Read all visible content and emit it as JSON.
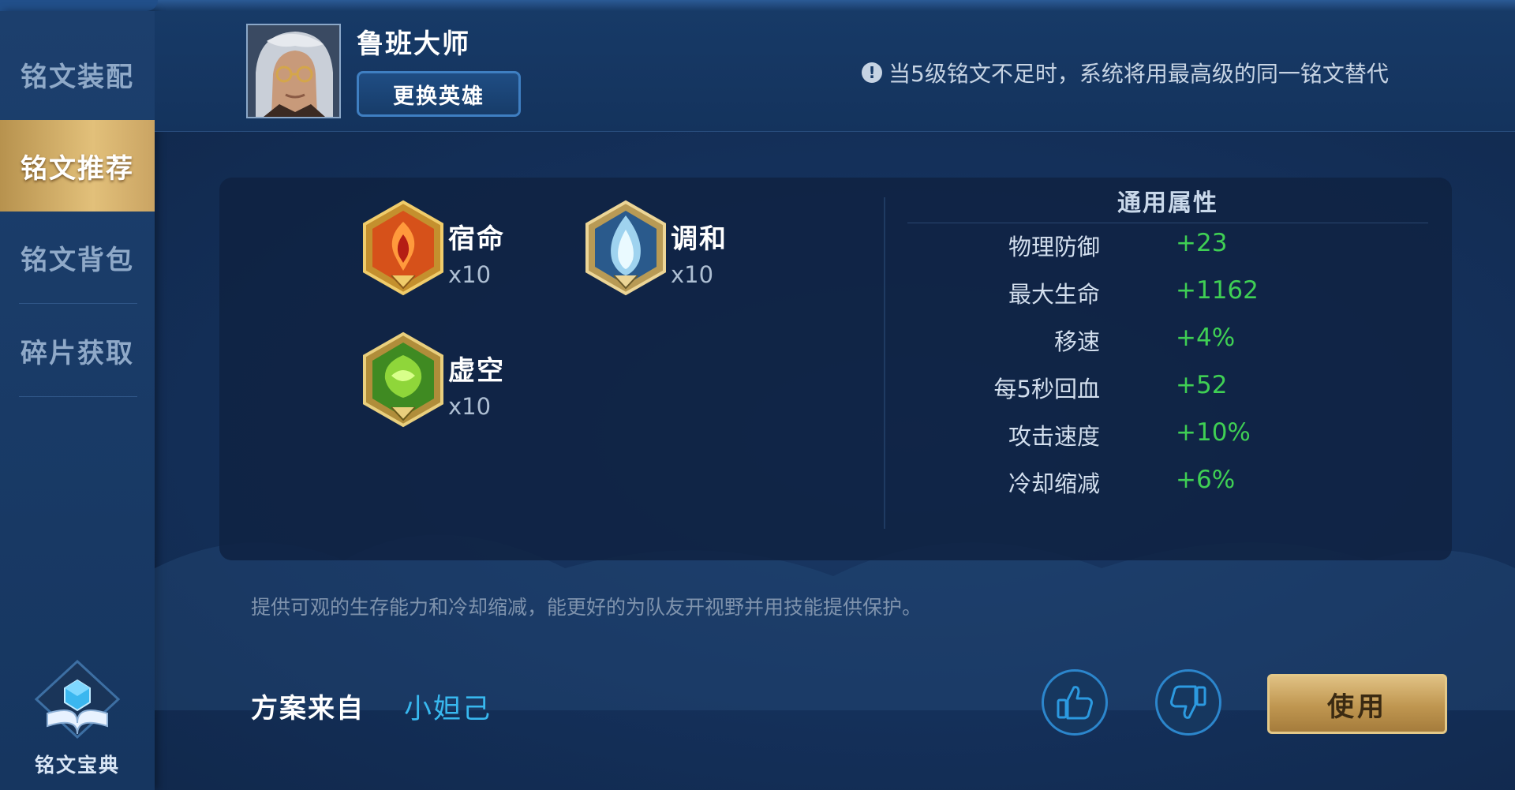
{
  "sidebar": {
    "items": [
      {
        "label": "铭文装配"
      },
      {
        "label": "铭文推荐"
      },
      {
        "label": "铭文背包"
      },
      {
        "label": "碎片获取"
      }
    ],
    "codex_label": "铭文宝典"
  },
  "header": {
    "hero_name": "鲁班大师",
    "change_hero_label": "更换英雄",
    "notice": "当5级铭文不足时，系统将用最高级的同一铭文替代"
  },
  "runes": [
    {
      "name": "宿命",
      "count": "x10",
      "color": "red-icon"
    },
    {
      "name": "调和",
      "count": "x10",
      "color": "blue-icon"
    },
    {
      "name": "虚空",
      "count": "x10",
      "color": "green-icon"
    }
  ],
  "attributes": {
    "title": "通用属性",
    "rows": [
      {
        "label": "物理防御",
        "value": "+23"
      },
      {
        "label": "最大生命",
        "value": "+1162"
      },
      {
        "label": "移速",
        "value": "+4%"
      },
      {
        "label": "每5秒回血",
        "value": "+52"
      },
      {
        "label": "攻击速度",
        "value": "+10%"
      },
      {
        "label": "冷却缩减",
        "value": "+6%"
      }
    ]
  },
  "description": "提供可观的生存能力和冷却缩减，能更好的为队友开视野并用技能提供保护。",
  "source": {
    "label": "方案来自",
    "author": "小妲己"
  },
  "actions": {
    "use_label": "使用"
  },
  "colors": {
    "accent_gold": "#d4b06a",
    "value_green": "#3fcf54",
    "author_cyan": "#38b8ef",
    "button_blue": "#2c86cc"
  }
}
